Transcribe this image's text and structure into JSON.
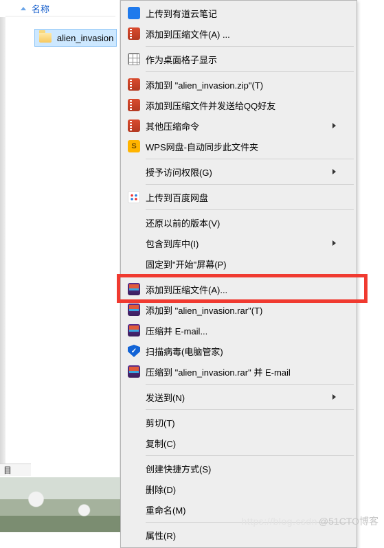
{
  "explorer": {
    "column_header": "名称",
    "selected_folder": "alien_invasion",
    "status_label": "目"
  },
  "menu": {
    "items": [
      {
        "icon": "ico-note",
        "label": "上传到有道云笔记",
        "arrow": false
      },
      {
        "icon": "ico-zip",
        "label": "添加到压缩文件(A) ...",
        "arrow": false
      },
      {
        "sep": true
      },
      {
        "icon": "ico-grid",
        "label": "作为桌面格子显示",
        "arrow": false
      },
      {
        "sep": true
      },
      {
        "icon": "ico-zip",
        "label": "添加到 \"alien_invasion.zip\"(T)",
        "arrow": false
      },
      {
        "icon": "ico-zip",
        "label": "添加到压缩文件并发送给QQ好友",
        "arrow": false
      },
      {
        "icon": "ico-zip",
        "label": "其他压缩命令",
        "arrow": true
      },
      {
        "icon": "ico-wps",
        "label": "WPS网盘-自动同步此文件夹",
        "arrow": false
      },
      {
        "sep": true
      },
      {
        "icon": "",
        "label": "授予访问权限(G)",
        "arrow": true
      },
      {
        "sep": true
      },
      {
        "icon": "ico-baidu",
        "label": "上传到百度网盘",
        "arrow": false
      },
      {
        "sep": true
      },
      {
        "icon": "",
        "label": "还原以前的版本(V)",
        "arrow": false
      },
      {
        "icon": "",
        "label": "包含到库中(I)",
        "arrow": true
      },
      {
        "icon": "",
        "label": "固定到\"开始\"屏幕(P)",
        "arrow": false
      },
      {
        "sep": true
      },
      {
        "icon": "ico-rar",
        "label": "添加到压缩文件(A)...",
        "arrow": false,
        "highlighted": true
      },
      {
        "icon": "ico-rar",
        "label": "添加到 \"alien_invasion.rar\"(T)",
        "arrow": false
      },
      {
        "icon": "ico-rar",
        "label": "压缩并 E-mail...",
        "arrow": false
      },
      {
        "icon": "ico-shield",
        "label": "扫描病毒(电脑管家)",
        "arrow": false
      },
      {
        "icon": "ico-rar",
        "label": "压缩到 \"alien_invasion.rar\" 并 E-mail",
        "arrow": false
      },
      {
        "sep": true
      },
      {
        "icon": "",
        "label": "发送到(N)",
        "arrow": true
      },
      {
        "sep": true
      },
      {
        "icon": "",
        "label": "剪切(T)",
        "arrow": false
      },
      {
        "icon": "",
        "label": "复制(C)",
        "arrow": false
      },
      {
        "sep": true
      },
      {
        "icon": "",
        "label": "创建快捷方式(S)",
        "arrow": false
      },
      {
        "icon": "",
        "label": "删除(D)",
        "arrow": false
      },
      {
        "icon": "",
        "label": "重命名(M)",
        "arrow": false
      },
      {
        "sep": true
      },
      {
        "icon": "",
        "label": "属性(R)",
        "arrow": false
      }
    ]
  },
  "watermark": {
    "faint": "https://blog.csdn",
    "text": "@51CTO博客"
  }
}
